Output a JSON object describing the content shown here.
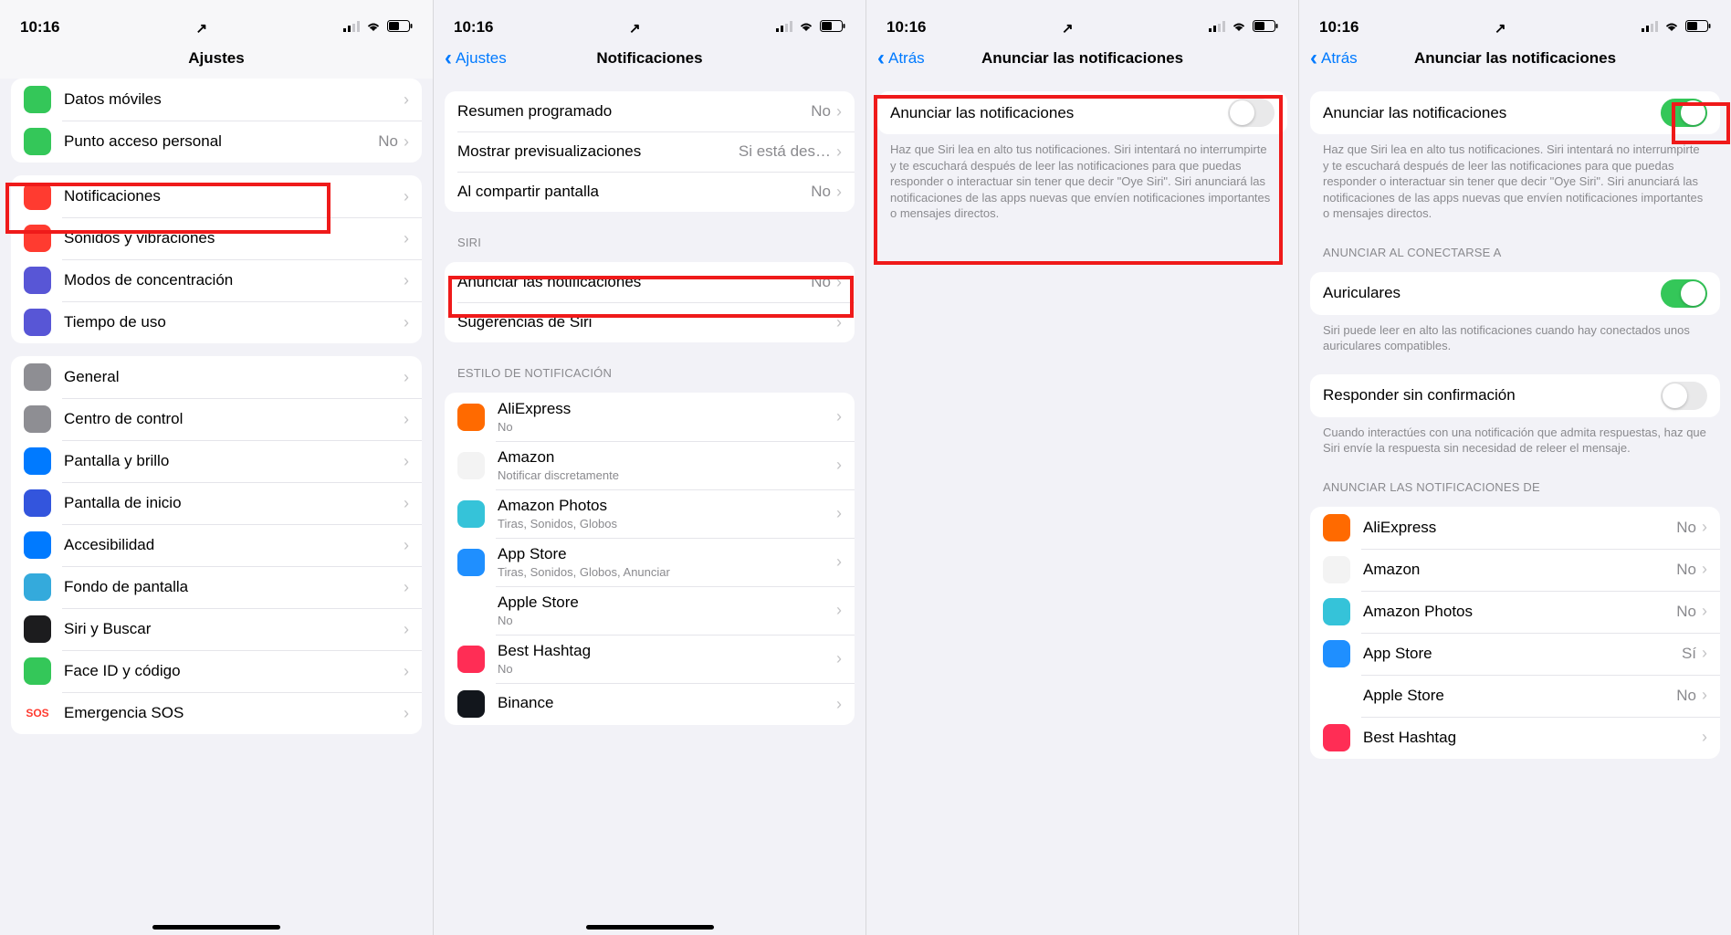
{
  "status": {
    "time": "10:16"
  },
  "s1": {
    "title": "Ajustes",
    "rows_top": [
      {
        "label": "Datos móviles",
        "icon_bg": "#34c759"
      },
      {
        "label": "Punto acceso personal",
        "val": "No",
        "icon_bg": "#34c759"
      }
    ],
    "rows_mid": [
      {
        "label": "Notificaciones",
        "icon_bg": "#ff3b30"
      },
      {
        "label": "Sonidos y vibraciones",
        "icon_bg": "#ff3b30"
      },
      {
        "label": "Modos de concentración",
        "icon_bg": "#5856d6"
      },
      {
        "label": "Tiempo de uso",
        "icon_bg": "#5856d6"
      }
    ],
    "rows_bot": [
      {
        "label": "General",
        "icon_bg": "#8e8e93"
      },
      {
        "label": "Centro de control",
        "icon_bg": "#8e8e93"
      },
      {
        "label": "Pantalla y brillo",
        "icon_bg": "#007aff"
      },
      {
        "label": "Pantalla de inicio",
        "icon_bg": "#3355dd"
      },
      {
        "label": "Accesibilidad",
        "icon_bg": "#007aff"
      },
      {
        "label": "Fondo de pantalla",
        "icon_bg": "#34aadc"
      },
      {
        "label": "Siri y Buscar",
        "icon_bg": "#1c1c1e"
      },
      {
        "label": "Face ID y código",
        "icon_bg": "#34c759"
      },
      {
        "label": "Emergencia SOS",
        "icon_bg": "#ffffff",
        "icon_fg": "#ff3b30",
        "icon_text": "SOS"
      }
    ]
  },
  "s2": {
    "back": "Ajustes",
    "title": "Notificaciones",
    "g1": [
      {
        "label": "Resumen programado",
        "val": "No"
      },
      {
        "label": "Mostrar previsualizaciones",
        "val": "Si está des…"
      },
      {
        "label": "Al compartir pantalla",
        "val": "No"
      }
    ],
    "h_siri": "SIRI",
    "g2": [
      {
        "label": "Anunciar las notificaciones",
        "val": "No"
      },
      {
        "label": "Sugerencias de Siri"
      }
    ],
    "h_style": "ESTILO DE NOTIFICACIÓN",
    "apps": [
      {
        "label": "AliExpress",
        "sub": "No",
        "icon_bg": "#ff6a00"
      },
      {
        "label": "Amazon",
        "sub": "Notificar discretamente",
        "icon_bg": "#f3f3f3"
      },
      {
        "label": "Amazon Photos",
        "sub": "Tiras, Sonidos, Globos",
        "icon_bg": "#35c3d9"
      },
      {
        "label": "App Store",
        "sub": "Tiras, Sonidos, Globos, Anunciar",
        "icon_bg": "#1f8fff"
      },
      {
        "label": "Apple Store",
        "sub": "No",
        "icon_bg": "#ffffff"
      },
      {
        "label": "Best Hashtag",
        "sub": "No",
        "icon_bg": "#ff2d55"
      },
      {
        "label": "Binance",
        "sub": "",
        "icon_bg": "#12161c"
      }
    ]
  },
  "s3": {
    "back": "Atrás",
    "title": "Anunciar las notificaciones",
    "toggle_label": "Anunciar las notificaciones",
    "toggle_on": false,
    "desc": "Haz que Siri lea en alto tus notificaciones. Siri intentará no interrumpirte y te escuchará después de leer las notificaciones para que puedas responder o interactuar sin tener que decir \"Oye Siri\". Siri anunciará las notificaciones de las apps nuevas que envíen notificaciones importantes o mensajes directos."
  },
  "s4": {
    "back": "Atrás",
    "title": "Anunciar las notificaciones",
    "toggle_label": "Anunciar las notificaciones",
    "toggle_on": true,
    "desc": "Haz que Siri lea en alto tus notificaciones. Siri intentará no interrumpirte y te escuchará después de leer las notificaciones para que puedas responder o interactuar sin tener que decir \"Oye Siri\". Siri anunciará las notificaciones de las apps nuevas que envíen notificaciones importantes o mensajes directos.",
    "h_connect": "ANUNCIAR AL CONECTARSE A",
    "row_headphones": "Auriculares",
    "headphones_on": true,
    "foot_headphones": "Siri puede leer en alto las notificaciones cuando hay conectados unos auriculares compatibles.",
    "row_reply": "Responder sin confirmación",
    "reply_on": false,
    "foot_reply": "Cuando interactúes con una notificación que admita respuestas, haz que Siri envíe la respuesta sin necesidad de releer el mensaje.",
    "h_apps": "ANUNCIAR LAS NOTIFICACIONES DE",
    "apps": [
      {
        "label": "AliExpress",
        "val": "No",
        "icon_bg": "#ff6a00"
      },
      {
        "label": "Amazon",
        "val": "No",
        "icon_bg": "#f3f3f3"
      },
      {
        "label": "Amazon Photos",
        "val": "No",
        "icon_bg": "#35c3d9"
      },
      {
        "label": "App Store",
        "val": "Sí",
        "icon_bg": "#1f8fff"
      },
      {
        "label": "Apple Store",
        "val": "No",
        "icon_bg": "#ffffff"
      },
      {
        "label": "Best Hashtag",
        "val": "",
        "icon_bg": "#ff2d55"
      }
    ]
  }
}
